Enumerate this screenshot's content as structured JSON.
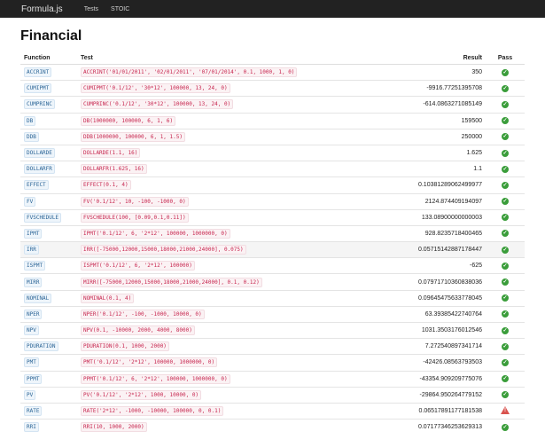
{
  "navbar": {
    "brand": "Formula.js",
    "links": [
      "Tests",
      "STOIC"
    ]
  },
  "page": {
    "title": "Financial"
  },
  "table": {
    "headers": {
      "function": "Function",
      "test": "Test",
      "result": "Result",
      "pass": "Pass"
    },
    "rows": [
      {
        "fn": "ACCRINT",
        "test": "ACCRINT('01/01/2011', '02/01/2011', '07/01/2014', 0.1, 1000, 1, 0)",
        "result": "350",
        "pass": "check-icon"
      },
      {
        "fn": "CUMIPMT",
        "test": "CUMIPMT('0.1/12', '30*12', 100000, 13, 24, 0)",
        "result": "-9916.77251395708",
        "pass": "check-icon"
      },
      {
        "fn": "CUMPRINC",
        "test": "CUMPRINC('0.1/12', '30*12', 100000, 13, 24, 0)",
        "result": "-614.0863271085149",
        "pass": "check-icon"
      },
      {
        "fn": "DB",
        "test": "DB(1000000, 100000, 6, 1, 6)",
        "result": "159500",
        "pass": "check-icon"
      },
      {
        "fn": "DDB",
        "test": "DDB(1000000, 100000, 6, 1, 1.5)",
        "result": "250000",
        "pass": "check-icon"
      },
      {
        "fn": "DOLLARDE",
        "test": "DOLLARDE(1.1, 16)",
        "result": "1.625",
        "pass": "check-icon"
      },
      {
        "fn": "DOLLARFR",
        "test": "DOLLARFR(1.625, 16)",
        "result": "1.1",
        "pass": "check-icon"
      },
      {
        "fn": "EFFECT",
        "test": "EFFECT(0.1, 4)",
        "result": "0.10381289062499977",
        "pass": "check-icon"
      },
      {
        "fn": "FV",
        "test": "FV('0.1/12', 10, -100, -1000, 0)",
        "result": "2124.874409194097",
        "pass": "check-icon"
      },
      {
        "fn": "FVSCHEDULE",
        "test": "FVSCHEDULE(100, [0.09,0.1,0.11])",
        "result": "133.08900000000003",
        "pass": "check-icon"
      },
      {
        "fn": "IPMT",
        "test": "IPMT('0.1/12', 6, '2*12', 100000, 1000000, 0)",
        "result": "928.8235718400465",
        "pass": "check-icon"
      },
      {
        "fn": "IRR",
        "test": "IRR([-75000,12000,15000,18000,21000,24000], 0.075)",
        "result": "0.05715142887178447",
        "pass": "check-icon"
      },
      {
        "fn": "ISPMT",
        "test": "ISPMT('0.1/12', 6, '2*12', 100000)",
        "result": "-625",
        "pass": "check-icon"
      },
      {
        "fn": "MIRR",
        "test": "MIRR([-75000,12000,15000,18000,21000,24000], 0.1, 0.12)",
        "result": "0.07971710360838036",
        "pass": "check-icon"
      },
      {
        "fn": "NOMINAL",
        "test": "NOMINAL(0.1, 4)",
        "result": "0.09645475633778045",
        "pass": "check-icon"
      },
      {
        "fn": "NPER",
        "test": "NPER('0.1/12', -100, -1000, 10000, 0)",
        "result": "63.39385422740764",
        "pass": "check-icon"
      },
      {
        "fn": "NPV",
        "test": "NPV(0.1, -10000, 2000, 4000, 8000)",
        "result": "1031.3503176012546",
        "pass": "check-icon"
      },
      {
        "fn": "PDURATION",
        "test": "PDURATION(0.1, 1000, 2000)",
        "result": "7.272540897341714",
        "pass": "check-icon"
      },
      {
        "fn": "PMT",
        "test": "PMT('0.1/12', '2*12', 100000, 1000000, 0)",
        "result": "-42426.08563793503",
        "pass": "check-icon"
      },
      {
        "fn": "PPMT",
        "test": "PPMT('0.1/12', 6, '2*12', 100000, 1000000, 0)",
        "result": "-43354.909209775076",
        "pass": "check-icon"
      },
      {
        "fn": "PV",
        "test": "PV('0.1/12', '2*12', 1000, 10000, 0)",
        "result": "-29864.950264779152",
        "pass": "check-icon"
      },
      {
        "fn": "RATE",
        "test": "RATE('2*12', -1000, -10000, 100000, 0, 0.1)",
        "result": "0.06517891177181538",
        "pass": "warning-icon"
      },
      {
        "fn": "RRI",
        "test": "RRI(10, 1000, 2000)",
        "result": "0.07177346253629313",
        "pass": "check-icon"
      }
    ],
    "highlighted_row": 11
  }
}
